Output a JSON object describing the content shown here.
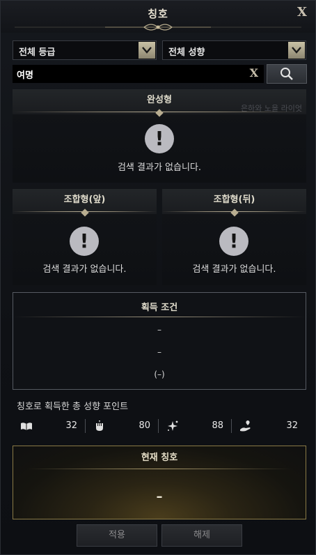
{
  "window": {
    "title": "칭호",
    "close_label": "X"
  },
  "filters": {
    "grade": {
      "selected": "전체 등급"
    },
    "tendency": {
      "selected": "전체 성향"
    }
  },
  "search": {
    "value": "여명",
    "placeholder": "",
    "clear_label": "X"
  },
  "panels": {
    "complete": {
      "title": "완성형",
      "empty": "검색 결과가 없습니다.",
      "ghost": "은하와 노을 라이엇"
    },
    "front": {
      "title": "조합형(앞)",
      "empty": "검색 결과가 없습니다."
    },
    "back": {
      "title": "조합형(뒤)",
      "empty": "검색 결과가 없습니다."
    }
  },
  "condition": {
    "title": "획득 조건",
    "line1": "–",
    "line2": "–",
    "line3": "(–)"
  },
  "points": {
    "title": "칭호로 획득한 총 성향 포인트",
    "items": [
      {
        "icon": "book-icon",
        "value": "32"
      },
      {
        "icon": "fist-icon",
        "value": "80"
      },
      {
        "icon": "sparkle-icon",
        "value": "88"
      },
      {
        "icon": "heart-hand-icon",
        "value": "32"
      }
    ]
  },
  "current": {
    "title": "현재 칭호",
    "value": "–"
  },
  "buttons": {
    "apply": "적용",
    "release": "해제"
  },
  "colors": {
    "accent_gold": "#b8ad90",
    "current_border": "#8a7a45"
  }
}
